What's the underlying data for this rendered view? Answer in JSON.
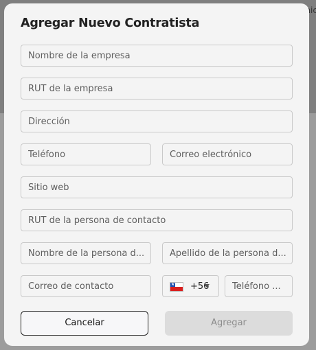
{
  "background": {
    "corner_text": "nic"
  },
  "modal": {
    "title": "Agregar Nuevo Contratista",
    "fields": {
      "company_name": "Nombre de la empresa",
      "company_rut": "RUT de la empresa",
      "address": "Dirección",
      "phone": "Teléfono",
      "email": "Correo electrónico",
      "website": "Sitio web",
      "contact_rut": "RUT de la persona de contacto",
      "contact_first_name": "Nombre de la persona d...",
      "contact_last_name": "Apellido de la persona d...",
      "contact_email": "Correo de contacto",
      "country_code": "+56",
      "contact_phone": "Teléfono ..."
    },
    "country_flag": "chile-flag-icon",
    "buttons": {
      "cancel": "Cancelar",
      "add": "Agregar"
    },
    "colors": {
      "add_disabled_bg": "#dcdcdc",
      "cancel_border": "#222222"
    }
  }
}
